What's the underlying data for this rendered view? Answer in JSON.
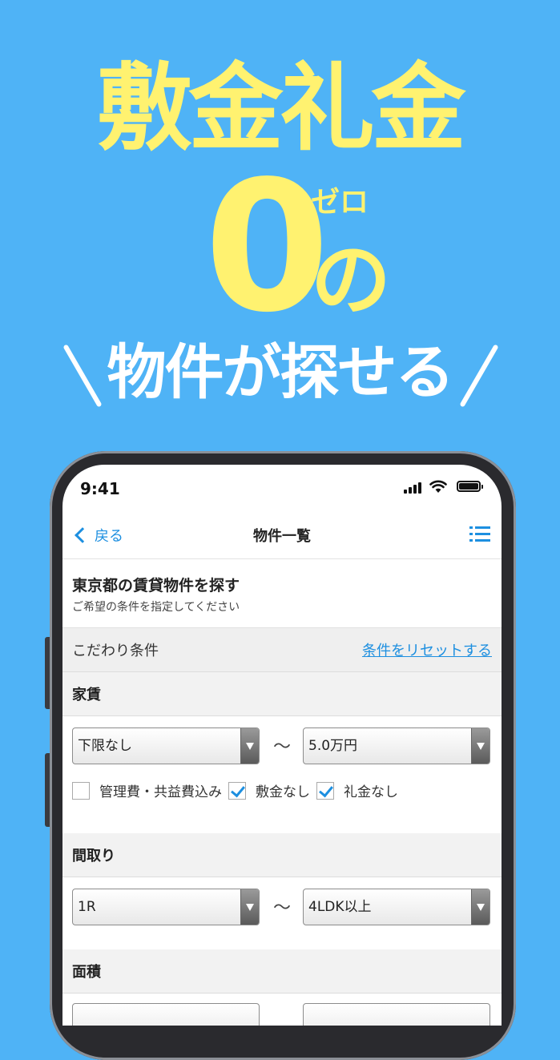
{
  "promo": {
    "headline": "敷金礼金",
    "zero": "0",
    "zero_ruby": "ゼロ",
    "zero_particle": "の",
    "subline": "物件が探せる"
  },
  "status_bar": {
    "time": "9:41"
  },
  "nav": {
    "back_label": "戻る",
    "title": "物件一覧"
  },
  "header": {
    "title": "東京都の賃貸物件を探す",
    "subtitle": "ご希望の条件を指定してください"
  },
  "conditions": {
    "label": "こだわり条件",
    "reset_label": "条件をリセットする"
  },
  "rent": {
    "label": "家賃",
    "min": "下限なし",
    "separator": "〜",
    "max": "5.0万円",
    "checkboxes": [
      {
        "label": "管理費・共益費込み",
        "checked": false
      },
      {
        "label": "敷金なし",
        "checked": true
      },
      {
        "label": "礼金なし",
        "checked": true
      }
    ]
  },
  "layout": {
    "label": "間取り",
    "min": "1R",
    "separator": "〜",
    "max": "4LDK以上"
  },
  "area": {
    "label": "面積"
  },
  "colors": {
    "background": "#4fb3f6",
    "headline": "#fff270",
    "accent": "#1d8fe0"
  }
}
